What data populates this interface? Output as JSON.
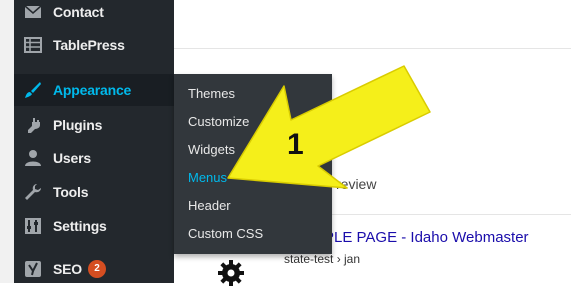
{
  "sidebar": {
    "items": [
      {
        "label": "Contact",
        "icon": "envelope-icon"
      },
      {
        "label": "TablePress",
        "icon": "table-icon"
      },
      {
        "label": "Appearance",
        "icon": "paintbrush-icon"
      },
      {
        "label": "Plugins",
        "icon": "plug-icon"
      },
      {
        "label": "Users",
        "icon": "user-icon"
      },
      {
        "label": "Tools",
        "icon": "wrench-icon"
      },
      {
        "label": "Settings",
        "icon": "sliders-icon"
      },
      {
        "label": "SEO",
        "icon": "yoast-icon",
        "badge": "2"
      }
    ]
  },
  "flyout": {
    "items": [
      {
        "label": "Themes"
      },
      {
        "label": "Customize"
      },
      {
        "label": "Widgets"
      },
      {
        "label": "Menus"
      },
      {
        "label": "Header"
      },
      {
        "label": "Custom CSS"
      }
    ]
  },
  "content": {
    "preview_label": "review",
    "result_title": "PLE PAGE - Idaho Webmaster",
    "result_url": "state-test › jan"
  },
  "annotation": {
    "number": "1",
    "arrow_color": "#f5ef1a"
  },
  "colors": {
    "sidebar_bg": "#23282d",
    "flyout_bg": "#32373c",
    "accent": "#00b9eb",
    "badge": "#d54e21"
  }
}
